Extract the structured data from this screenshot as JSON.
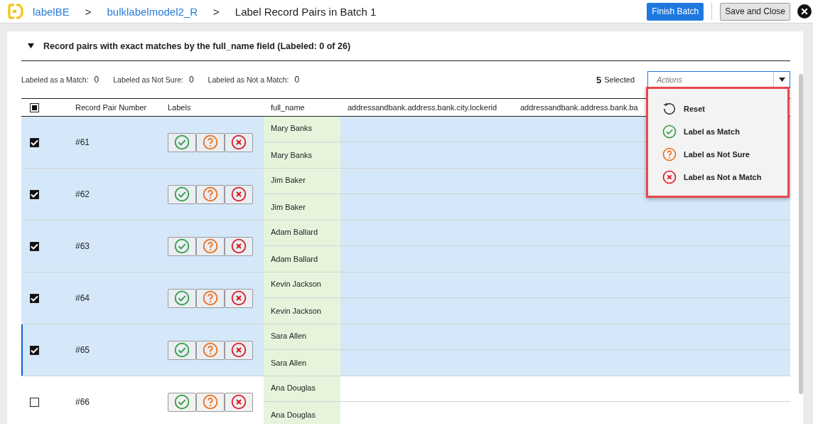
{
  "breadcrumb": {
    "items": [
      {
        "label": "labelBE",
        "kind": "link"
      },
      {
        "label": ">",
        "kind": "separator"
      },
      {
        "label": "bulklabelmodel2_R",
        "kind": "link"
      },
      {
        "label": ">",
        "kind": "separator"
      },
      {
        "label": "Label Record Pairs in Batch 1",
        "kind": "current"
      }
    ]
  },
  "header_buttons": [
    {
      "label": "Finish Batch",
      "kind": "primary"
    },
    {
      "label": "Save and Close",
      "kind": "secondary"
    }
  ],
  "section": {
    "title": "Record pairs with exact matches by the full_name field (Labeled: 0 of 26)",
    "expanded": true
  },
  "counts": [
    {
      "label": "Labeled as a Match:",
      "value": "0"
    },
    {
      "label": "Labeled as Not Sure:",
      "value": "0"
    },
    {
      "label": "Labeled as Not a Match:",
      "value": "0"
    }
  ],
  "selection": {
    "count": "5",
    "label": "Selected"
  },
  "actions": {
    "placeholder": "Actions",
    "expanded": true,
    "items": [
      {
        "label": "Reset",
        "kind": "reset"
      },
      {
        "label": "Label as Match",
        "kind": "match"
      },
      {
        "label": "Label as Not Sure",
        "kind": "unsure"
      },
      {
        "label": "Label as Not a Match",
        "kind": "nomatch"
      }
    ]
  },
  "table": {
    "select_all": {
      "checked": false,
      "indeterminate": true
    },
    "columns": [
      "Record Pair Number",
      "Labels",
      "full_name",
      "addressandbank.address.bank.city.lockerid",
      "addressandbank.address.bank.ba"
    ],
    "rows": [
      {
        "number": "#61",
        "selected": true,
        "focused": false,
        "names": [
          "Mary Banks",
          "Mary Banks"
        ]
      },
      {
        "number": "#62",
        "selected": true,
        "focused": false,
        "names": [
          "Jim Baker",
          "Jim Baker"
        ]
      },
      {
        "number": "#63",
        "selected": true,
        "focused": false,
        "names": [
          "Adam Ballard",
          "Adam Ballard"
        ]
      },
      {
        "number": "#64",
        "selected": true,
        "focused": false,
        "names": [
          "Kevin Jackson",
          "Kevin Jackson"
        ]
      },
      {
        "number": "#65",
        "selected": true,
        "focused": true,
        "names": [
          "Sara Allen",
          "Sara Allen"
        ]
      },
      {
        "number": "#66",
        "selected": false,
        "focused": false,
        "names": [
          "Ana Douglas",
          "Ana Douglas"
        ]
      }
    ]
  }
}
